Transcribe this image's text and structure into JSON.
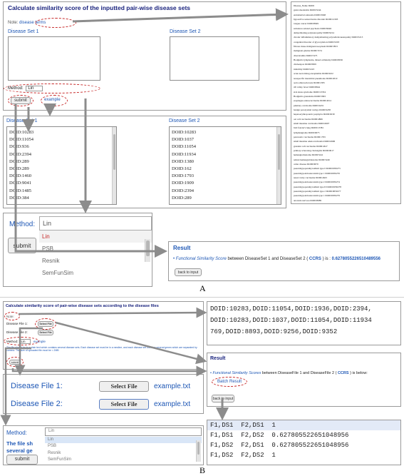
{
  "a": {
    "title": "Calculate similarity score of the inputted pair-wise disease sets",
    "note_prefix": "Note:",
    "note_link": "disease terms",
    "set1_label": "Disease Set 1",
    "set2_label": "Disease Set 2",
    "method_label": "Method:",
    "method_value": "Lin",
    "submit": "submit",
    "example": "example",
    "terms_header": [
      "Disease_Name",
      "DOID"
    ],
    "terms": [
      [
        "gastroduodenitis",
        "DOID:3244"
      ],
      [
        "endometrial adenoma",
        "DOID:3048"
      ],
      [
        "hypoactive sexual desire disorder",
        "DOID:12303"
      ],
      [
        "tongue cancer",
        "DOID:8649"
      ],
      [
        "substance-related psychosis",
        "DOID:9646"
      ],
      [
        "demyelinating polyneuropathy",
        "DOID:9214"
      ],
      [
        "chronic inflammatory demyelinating polyradiculoneuropathy",
        "DOID:5213"
      ],
      [
        "congenital disorder of glycosylation",
        "DOID:5203"
      ],
      [
        "fibrous tissue malignant neoplasm",
        "DOID:5853"
      ],
      [
        "malignant glioma",
        "DOID:7474"
      ],
      [
        "diverticulitis",
        "DOID:7475"
      ],
      [
        "Hodgkin's lymphoma, mixed cellularity",
        "DOID:8650"
      ],
      [
        "chickenpox",
        "DOID:8659"
      ],
      [
        "infertility",
        "DOID:5223"
      ],
      [
        "acute necrotizing encephalitis",
        "DOID:9222"
      ],
      [
        "nonspecific interstitial pneumonia",
        "DOID:2010"
      ],
      [
        "aorta atherosclerosis",
        "DOID:1383"
      ],
      [
        "rift valley fever",
        "DOID:8644"
      ],
      [
        "sick sinus syndrome",
        "DOID:13334"
      ],
      [
        "Hodgkin's granuloma",
        "DOID:5993"
      ],
      [
        "esophagus adenocarcinoma",
        "DOID:4914"
      ],
      [
        "pituitary carcinoma",
        "DOID:4431"
      ],
      [
        "benign paroxysmal vertigo",
        "DOID:9238"
      ],
      [
        "hepatoerythropoietic porphyria",
        "DOID:9239"
      ],
      [
        "oat cell carcinoma",
        "DOID:4866"
      ],
      [
        "small intestine carcinoma",
        "DOID:4907"
      ],
      [
        "bird fancier's lung",
        "DOID:13381"
      ],
      [
        "lymphangioma",
        "DOID:0675"
      ],
      [
        "pancreatic carcinoma",
        "DOID:1793"
      ],
      [
        "small intestine adenocarcinoma",
        "DOID:4906"
      ],
      [
        "granular cell carcinoma",
        "DOID:4617"
      ],
      [
        "primary sclerosing cholangitis",
        "DOID:0617"
      ],
      [
        "hemangioblastoma",
        "DOID:5241"
      ],
      [
        "retinal hemangioblastoma",
        "DOID:5246"
      ],
      [
        "celiac disease",
        "DOID:9679"
      ],
      [
        "pseudohypoparathyroidism type I",
        "DOID:0050275"
      ],
      [
        "pseudohypoaldosteronism type 1",
        "DOID:0050276"
      ],
      [
        "nasal cavity carcinoma",
        "DOID:4623"
      ],
      [
        "pseudohypoaldosteronism type 2",
        "DOID:0050274"
      ],
      [
        "pseudohypoparathyroidism type II",
        "DOID:0050278"
      ],
      [
        "pseudohypoparathyroidism type 2",
        "DOID:0050277"
      ],
      [
        "pseudohypoaldosteronism type 1",
        "DOID:0050279"
      ],
      [
        "anorexia nervosa",
        "DOID:8689"
      ]
    ],
    "set1_values": [
      "DOID:10283",
      "DOID:11054",
      "DOID:936",
      "DOID:2394",
      "DOID:289",
      "DOID:289",
      "DOID:1460",
      "DOID:9041",
      "DOID:1485",
      "DOID:384"
    ],
    "set2_values": [
      "DOID:10283",
      "DOID:1037",
      "DOID:11054",
      "DOID:11934",
      "DOID:1380",
      "DOID:162",
      "DOID:1793",
      "DOID:1909",
      "DOID:2394",
      "DOID:289"
    ],
    "method_options": [
      "Lin",
      "PSB",
      "Resnik",
      "SemFunSim"
    ],
    "result_title": "Result",
    "result_prefix": "Functional Similarity Score",
    "result_mid": "between DiseaseSet 1 and DiseaseSet 2 (",
    "result_ccrs": "CCRS",
    "result_end": ") is :",
    "result_value": "0.6278055226510489556",
    "back_btn": "back to input",
    "caption": "A"
  },
  "b": {
    "title": "Calculate similarity score of pair-wise disease sets according to the disease files",
    "note_prefix": "Note:",
    "file1_label": "Disease File 1:",
    "file2_label": "Disease File 2:",
    "select_file": "Select File",
    "method_label": "Method:",
    "method_value": "Lin",
    "example": "example",
    "submit": "submit",
    "help_text": "The file should be in a plain text which contains several disease sets. Each disease set must be in a newline, and each disease set contains several genes which are separated by comma. The size of uploaded file must be < 2MB",
    "doid_line1": "DOID:10283,DOID:11054,DOID:1936,DOID:2394,",
    "doid_line2": "DOID:10283,DOID:1037,DOID:11054,DOID:11934",
    "doid_line3": "769,DOID:8893,DOID:9256,DOID:9352",
    "result_title": "Result",
    "result_prefix": "Functional Similarity Scores",
    "result_mid": "between DiseaseFile 1 and DiseaseFile 2 (",
    "result_ccrs": "CCRS",
    "result_end": ") is below:",
    "batch_result": "Batch Result",
    "back_btn": "back to input",
    "zoom_file1": "Disease File 1:",
    "zoom_file2": "Disease File 2:",
    "zoom_select": "Select File",
    "zoom_example": "example.txt",
    "results_table": [
      [
        "F1,DS1",
        "F2,DS1",
        "1"
      ],
      [
        "F1,DS1",
        "F2,DS2",
        "0.627805522651048956"
      ],
      [
        "F1,DS2",
        "F2,DS1",
        "0.627805522651048956"
      ],
      [
        "F1,DS2",
        "F2,DS2",
        "1"
      ]
    ],
    "zoom_method_label": "Method:",
    "zoom_method_options": [
      "Lin",
      "Lin",
      "PSB",
      "Resnik",
      "SemFunSim"
    ],
    "zoom_help": "The file sh",
    "zoom_help2": "several ge",
    "zoom_submit": "submit",
    "caption": "B"
  },
  "colors": {
    "title": "#1a237e",
    "link": "#1e57b5",
    "annotation": "#c62828",
    "arrow": "#8c8c8c",
    "result": "#1e57b5"
  }
}
